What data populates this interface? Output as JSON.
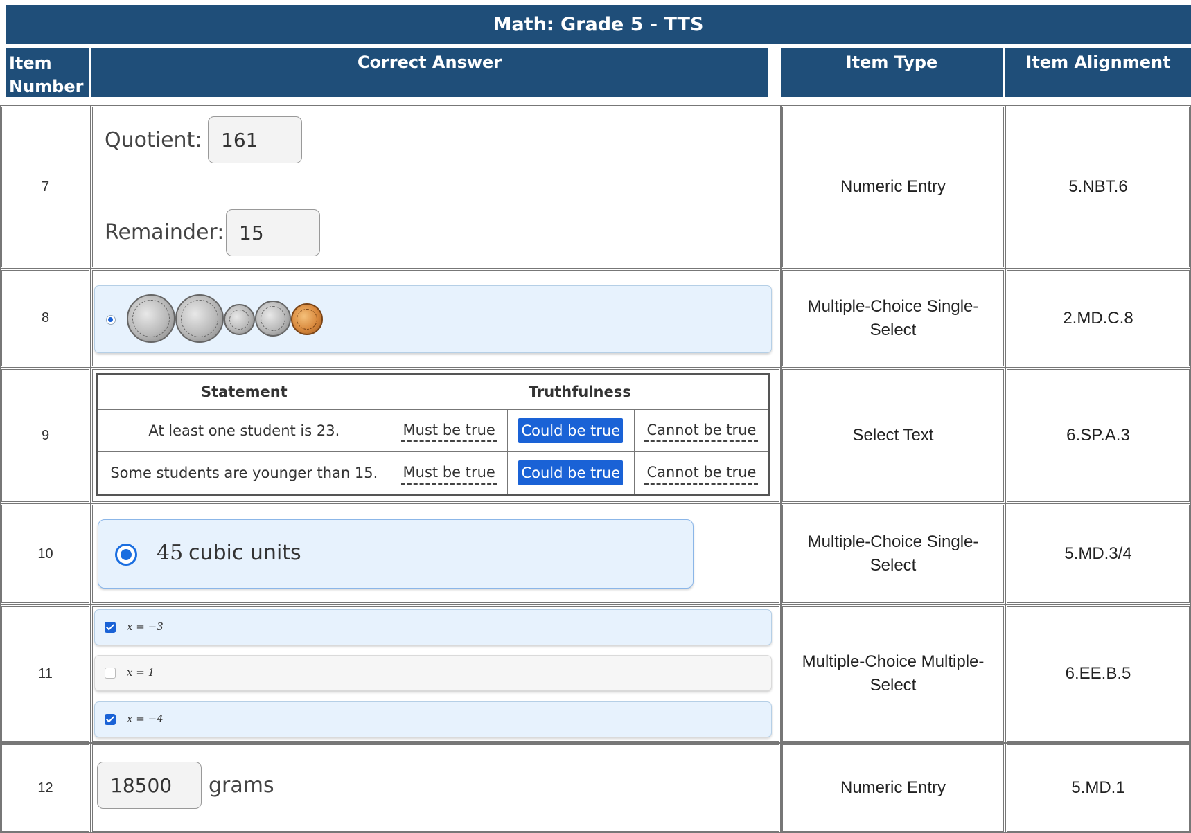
{
  "title": "Math: Grade 5 - TTS",
  "headers": {
    "item_number": "Item Number",
    "correct_answer": "Correct Answer",
    "item_type": "Item Type",
    "item_alignment": "Item Alignment"
  },
  "rows": [
    {
      "number": "7",
      "type": "Numeric Entry",
      "alignment": "5.NBT.6",
      "answer": {
        "quotient_label": "Quotient:",
        "quotient_value": "161",
        "remainder_label": "Remainder:",
        "remainder_value": "15"
      }
    },
    {
      "number": "8",
      "type": "Multiple-Choice Single-Select",
      "alignment": "2.MD.C.8",
      "answer": {
        "selected": true,
        "coins": [
          "quarter",
          "quarter",
          "dime",
          "nickel",
          "penny"
        ]
      }
    },
    {
      "number": "9",
      "type": "Select Text",
      "alignment": "6.SP.A.3",
      "answer": {
        "headers": [
          "Statement",
          "Truthfulness"
        ],
        "statements": [
          {
            "text": "At least one student is 23.",
            "options": [
              "Must be true",
              "Could be true",
              "Cannot be true"
            ],
            "selected": "Could be true"
          },
          {
            "text": "Some students are younger than 15.",
            "options": [
              "Must be true",
              "Could be true",
              "Cannot be true"
            ],
            "selected": "Could be true"
          }
        ]
      }
    },
    {
      "number": "10",
      "type": "Multiple-Choice Single-Select",
      "alignment": "5.MD.3/4",
      "answer": {
        "value": "45",
        "unit": "cubic units"
      }
    },
    {
      "number": "11",
      "type": "Multiple-Choice Multiple-Select",
      "alignment": "6.EE.B.5",
      "answer": {
        "options": [
          {
            "text": "x = −3",
            "checked": true
          },
          {
            "text": "x = 1",
            "checked": false
          },
          {
            "text": "x = −4",
            "checked": true
          }
        ]
      }
    },
    {
      "number": "12",
      "type": "Numeric Entry",
      "alignment": "5.MD.1",
      "answer": {
        "value": "18500",
        "unit": "grams"
      }
    }
  ],
  "colors": {
    "header_bg": "#1f4e79",
    "selected_blue": "#1a62d6",
    "choice_bg": "#e7f2fd"
  }
}
